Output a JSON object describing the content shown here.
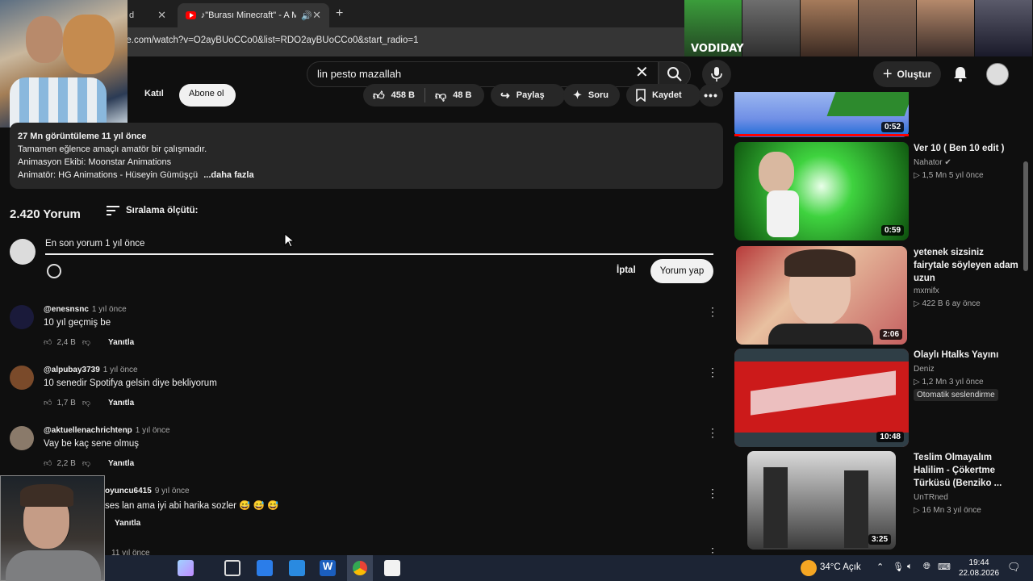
{
  "browser": {
    "tab_active_title": "♪\"Burası Minecraft\" - A Min",
    "tab_inactive_title": "d",
    "url": "be.com/watch?v=O2ayBUoCCo0&list=RDO2ayBUoCCo0&start_radio=1"
  },
  "overlay": {
    "stream_label": "VODIDAY"
  },
  "header": {
    "search_value": "lin pesto mazallah",
    "create_label": "Oluştur"
  },
  "actions": {
    "join_label": "Katıl",
    "subscribe_label": "Abone ol",
    "likes": "458 B",
    "dislikes": "48 B",
    "share_label": "Paylaş",
    "ask_label": "Soru",
    "save_label": "Kaydet"
  },
  "description": {
    "meta": "27 Mn görüntüleme  11 yıl önce",
    "line1": "Tamamen eğlence amaçlı amatör bir çalışmadır.",
    "line2": "Animasyon Ekibi: Moonstar Animations",
    "line3": "Animatör: HG Animations - Hüseyin Gümüşçü",
    "more": "...daha fazla"
  },
  "comments_header": {
    "count": "2.420 Yorum",
    "sort_label": "Sıralama ölçütü:"
  },
  "composer": {
    "value": "En son yorum 1 yıl önce",
    "cancel_label": "İptal",
    "submit_label": "Yorum yap"
  },
  "comments": [
    {
      "handle": "@enesnsnc",
      "time": "1 yıl önce",
      "text": "10 yıl geçmiş be",
      "likes": "2,4 B",
      "reply": "Yanıtla",
      "avatar_color": "#1a1a3a"
    },
    {
      "handle": "@alpubay3739",
      "time": "1 yıl önce",
      "text": "10 senedir Spotifya gelsin diye bekliyorum",
      "likes": "1,7 B",
      "reply": "Yanıtla",
      "avatar_color": "#7a4a2a"
    },
    {
      "handle": "@aktuellenachrichtenp",
      "time": "1 yıl önce",
      "text": "Vay be kaç sene olmuş",
      "likes": "2,2 B",
      "reply": "Yanıtla",
      "avatar_color": "#8a7a6a"
    },
    {
      "handle": "oyuncu6415",
      "time": "9 yıl önce",
      "text": "ses lan ama iyi abi harika sozler 😅 😅 😅",
      "likes": "",
      "reply": "Yanıtla",
      "avatar_color": "#333"
    }
  ],
  "next_comment_time": "11 yıl önce",
  "sidebar": [
    {
      "title": "",
      "channel": "",
      "stats": "",
      "duration": "0:52",
      "badge": ""
    },
    {
      "title": "Ver 10 ( Ben 10 edit )",
      "channel": "Nahator ✔",
      "stats": "▷ 1,5 Mn  5 yıl önce",
      "duration": "0:59",
      "badge": ""
    },
    {
      "title": "yetenek sizsiniz fairytale söyleyen adam uzun",
      "channel": "mxmifx",
      "stats": "▷ 422 B  6 ay önce",
      "duration": "2:06",
      "badge": ""
    },
    {
      "title": "Olaylı Htalks Yayını",
      "channel": "Deniz",
      "stats": "▷ 1,2 Mn  3 yıl önce",
      "duration": "10:48",
      "badge": "Otomatik seslendirme"
    },
    {
      "title": "Teslim Olmayalım Halilim - Çökertme Türküsü (Benziko ...",
      "channel": "UnTRned",
      "stats": "▷ 16 Mn  3 yıl önce",
      "duration": "3:25",
      "badge": ""
    }
  ],
  "taskbar": {
    "weather": "34°C  Açık",
    "time": "19:44",
    "date": "22.08.2026"
  }
}
